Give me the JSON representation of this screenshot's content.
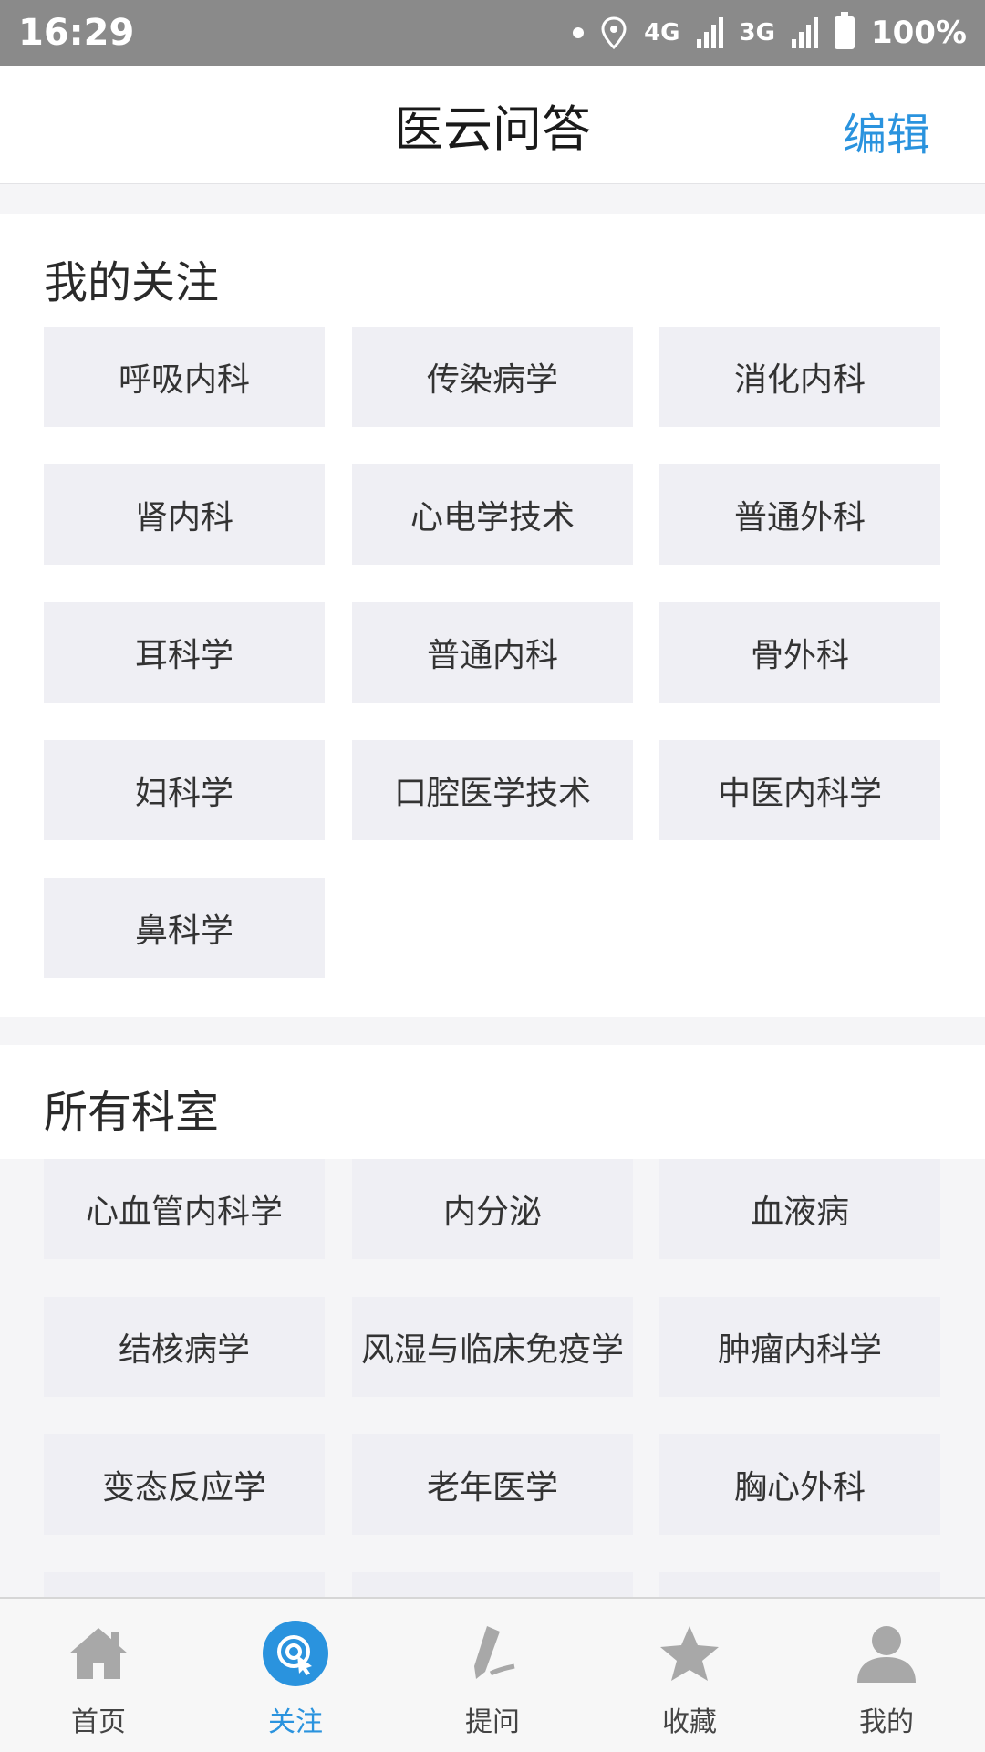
{
  "status": {
    "time": "16:29",
    "network_a": "4G",
    "network_b": "3G",
    "battery": "100%"
  },
  "header": {
    "title": "医云问答",
    "edit_label": "编辑"
  },
  "my_follow": {
    "title": "我的关注",
    "items": [
      "呼吸内科",
      "传染病学",
      "消化内科",
      "肾内科",
      "心电学技术",
      "普通外科",
      "耳科学",
      "普通内科",
      "骨外科",
      "妇科学",
      "口腔医学技术",
      "中医内科学",
      "鼻科学"
    ]
  },
  "all_departments": {
    "title": "所有科室",
    "items": [
      "心血管内科学",
      "内分泌",
      "血液病",
      "结核病学",
      "风湿与临床免疫学",
      "肿瘤内科学",
      "变态反应学",
      "老年医学",
      "胸心外科"
    ]
  },
  "bottom_nav": {
    "items": [
      {
        "label": "首页",
        "icon": "home-icon"
      },
      {
        "label": "关注",
        "icon": "follow-icon"
      },
      {
        "label": "提问",
        "icon": "pen-icon"
      },
      {
        "label": "收藏",
        "icon": "star-icon"
      },
      {
        "label": "我的",
        "icon": "person-icon"
      }
    ],
    "active": "关注"
  },
  "colors": {
    "accent": "#2a93de",
    "chip_bg": "#efeff4",
    "status_bar": "#8a8a8a"
  }
}
